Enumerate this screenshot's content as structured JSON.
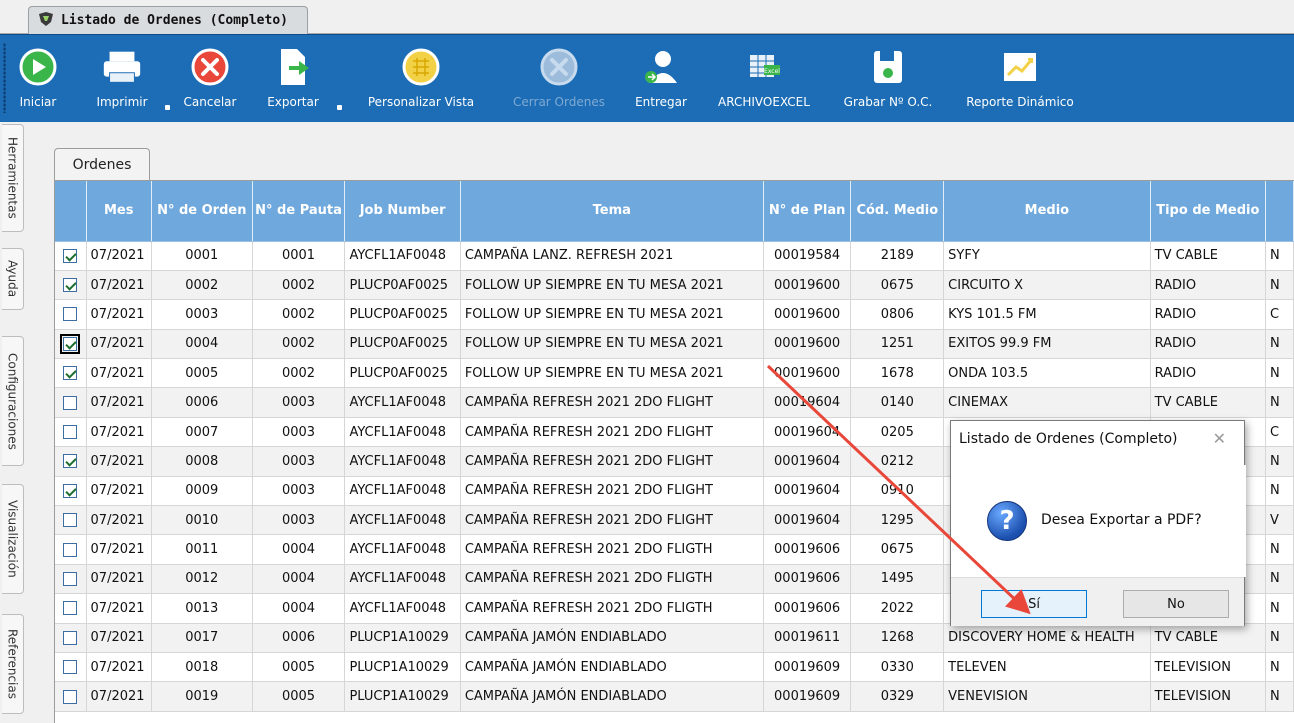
{
  "window": {
    "tab_title": "Listado de Ordenes (Completo)"
  },
  "toolbar": {
    "items": [
      {
        "label": "Iniciar",
        "icon": "play-icon"
      },
      {
        "label": "Imprimir",
        "icon": "printer-icon"
      },
      {
        "label": "Cancelar",
        "icon": "cancel-icon"
      },
      {
        "label": "Exportar",
        "icon": "export-icon"
      },
      {
        "label": "Personalizar Vista",
        "icon": "grid-view-icon"
      },
      {
        "label": "Cerrar Ordenes",
        "icon": "close-orders-icon",
        "disabled": true
      },
      {
        "label": "Entregar",
        "icon": "deliver-user-icon"
      },
      {
        "label": "ARCHIVOEXCEL",
        "icon": "excel-icon"
      },
      {
        "label": "Grabar Nº O.C.",
        "icon": "save-icon"
      },
      {
        "label": "Reporte Dinámico",
        "icon": "chart-icon"
      }
    ],
    "colors": {
      "ribbon": "#1c6db5"
    }
  },
  "sidebar": {
    "tabs": [
      {
        "label": "Herramientas"
      },
      {
        "label": "Ayuda"
      },
      {
        "label": "Configuraciones"
      },
      {
        "label": "Visualización"
      },
      {
        "label": "Referencias"
      }
    ]
  },
  "main": {
    "tab_label": "Ordenes",
    "columns": [
      "",
      "Mes",
      "N° de Orden",
      "N° de Pauta",
      "Job Number",
      "Tema",
      "N° de Plan",
      "Cód. Medio",
      "Medio",
      "Tipo de Medio",
      ""
    ],
    "rows": [
      {
        "checked": true,
        "mes": "07/2021",
        "orden": "0001",
        "pauta": "0001",
        "job": "AYCFL1AF0048",
        "tema": "CAMPAÑA LANZ. REFRESH 2021",
        "plan": "00019584",
        "cod": "2189",
        "medio": "SYFY",
        "tipo": "TV CABLE",
        "extra": "N"
      },
      {
        "checked": true,
        "mes": "07/2021",
        "orden": "0002",
        "pauta": "0002",
        "job": "PLUCP0AF0025",
        "tema": "FOLLOW UP SIEMPRE EN TU MESA 2021",
        "plan": "00019600",
        "cod": "0675",
        "medio": "CIRCUITO X",
        "tipo": "RADIO",
        "extra": "N"
      },
      {
        "checked": false,
        "mes": "07/2021",
        "orden": "0003",
        "pauta": "0002",
        "job": "PLUCP0AF0025",
        "tema": "FOLLOW UP SIEMPRE EN TU MESA 2021",
        "plan": "00019600",
        "cod": "0806",
        "medio": "KYS 101.5 FM",
        "tipo": "RADIO",
        "extra": "C"
      },
      {
        "checked": true,
        "focused": true,
        "mes": "07/2021",
        "orden": "0004",
        "pauta": "0002",
        "job": "PLUCP0AF0025",
        "tema": "FOLLOW UP SIEMPRE EN TU MESA 2021",
        "plan": "00019600",
        "cod": "1251",
        "medio": "EXITOS 99.9 FM",
        "tipo": "RADIO",
        "extra": "N"
      },
      {
        "checked": true,
        "mes": "07/2021",
        "orden": "0005",
        "pauta": "0002",
        "job": "PLUCP0AF0025",
        "tema": "FOLLOW UP SIEMPRE EN TU MESA 2021",
        "plan": "00019600",
        "cod": "1678",
        "medio": "ONDA 103.5",
        "tipo": "RADIO",
        "extra": "N"
      },
      {
        "checked": false,
        "mes": "07/2021",
        "orden": "0006",
        "pauta": "0003",
        "job": "AYCFL1AF0048",
        "tema": "CAMPAÑA REFRESH 2021 2DO FLIGHT",
        "plan": "00019604",
        "cod": "0140",
        "medio": "CINEMAX",
        "tipo": "TV CABLE",
        "extra": "N"
      },
      {
        "checked": false,
        "mes": "07/2021",
        "orden": "0007",
        "pauta": "0003",
        "job": "AYCFL1AF0048",
        "tema": "CAMPAÑA REFRESH 2021 2DO FLIGHT",
        "plan": "00019604",
        "cod": "0205",
        "medio": "",
        "tipo": "",
        "extra": "C"
      },
      {
        "checked": true,
        "mes": "07/2021",
        "orden": "0008",
        "pauta": "0003",
        "job": "AYCFL1AF0048",
        "tema": "CAMPAÑA REFRESH 2021 2DO FLIGHT",
        "plan": "00019604",
        "cod": "0212",
        "medio": "",
        "tipo": "",
        "extra": "N"
      },
      {
        "checked": true,
        "mes": "07/2021",
        "orden": "0009",
        "pauta": "0003",
        "job": "AYCFL1AF0048",
        "tema": "CAMPAÑA REFRESH 2021 2DO FLIGHT",
        "plan": "00019604",
        "cod": "0910",
        "medio": "",
        "tipo": "",
        "extra": "N"
      },
      {
        "checked": false,
        "mes": "07/2021",
        "orden": "0010",
        "pauta": "0003",
        "job": "AYCFL1AF0048",
        "tema": "CAMPAÑA REFRESH 2021 2DO FLIGHT",
        "plan": "00019604",
        "cod": "1295",
        "medio": "",
        "tipo": "",
        "extra": "V"
      },
      {
        "checked": false,
        "mes": "07/2021",
        "orden": "0011",
        "pauta": "0004",
        "job": "AYCFL1AF0048",
        "tema": "CAMPAÑA REFRESH 2021 2DO FLIGTH",
        "plan": "00019606",
        "cod": "0675",
        "medio": "",
        "tipo": "",
        "extra": "N"
      },
      {
        "checked": false,
        "mes": "07/2021",
        "orden": "0012",
        "pauta": "0004",
        "job": "AYCFL1AF0048",
        "tema": "CAMPAÑA REFRESH 2021 2DO FLIGTH",
        "plan": "00019606",
        "cod": "1495",
        "medio": "",
        "tipo": "",
        "extra": "N"
      },
      {
        "checked": false,
        "mes": "07/2021",
        "orden": "0013",
        "pauta": "0004",
        "job": "AYCFL1AF0048",
        "tema": "CAMPAÑA REFRESH 2021 2DO FLIGTH",
        "plan": "00019606",
        "cod": "2022",
        "medio": "",
        "tipo": "",
        "extra": "N"
      },
      {
        "checked": false,
        "mes": "07/2021",
        "orden": "0017",
        "pauta": "0006",
        "job": "PLUCP1A10029",
        "tema": "CAMPAÑA JAMÓN ENDIABLADO",
        "plan": "00019611",
        "cod": "1268",
        "medio": "DISCOVERY HOME & HEALTH",
        "tipo": "TV CABLE",
        "extra": "N"
      },
      {
        "checked": false,
        "mes": "07/2021",
        "orden": "0018",
        "pauta": "0005",
        "job": "PLUCP1A10029",
        "tema": "CAMPAÑA JAMÓN ENDIABLADO",
        "plan": "00019609",
        "cod": "0330",
        "medio": "TELEVEN",
        "tipo": "TELEVISION",
        "extra": "N"
      },
      {
        "checked": false,
        "mes": "07/2021",
        "orden": "0019",
        "pauta": "0005",
        "job": "PLUCP1A10029",
        "tema": "CAMPAÑA JAMÓN ENDIABLADO",
        "plan": "00019609",
        "cod": "0329",
        "medio": "VENEVISION",
        "tipo": "TELEVISION",
        "extra": "N"
      }
    ]
  },
  "dialog": {
    "title": "Listado de Ordenes (Completo)",
    "close_glyph": "✕",
    "message": "Desea Exportar a PDF?",
    "icon": "question-icon",
    "icon_glyph": "?",
    "yes_label": "Sí",
    "no_label": "No"
  },
  "annotation": {
    "arrow_color": "#e8473a"
  }
}
